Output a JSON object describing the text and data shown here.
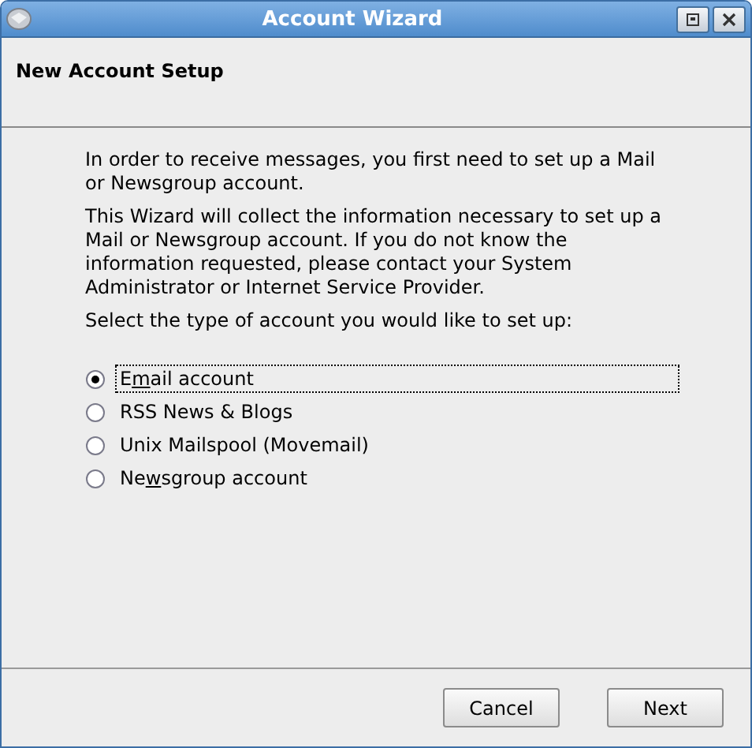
{
  "window": {
    "title": "Account Wizard"
  },
  "header": {
    "title": "New Account Setup"
  },
  "paragraphs": [
    "In order to receive messages, you first need to set up a Mail or Newsgroup account.",
    "This Wizard will collect the information necessary to set up a Mail or Newsgroup account. If you do not know the information requested, please contact your System Administrator or Internet Service Provider.",
    "Select the type of account you would like to set up:"
  ],
  "options": [
    {
      "label": "E",
      "mnemonic": "m",
      "label_rest": "ail account",
      "selected": true
    },
    {
      "label": "RSS News & Blogs",
      "selected": false
    },
    {
      "label": "Unix Mailspool (Movemail)",
      "selected": false
    },
    {
      "label": "Ne",
      "mnemonic": "w",
      "label_rest": "sgroup account",
      "selected": false
    }
  ],
  "buttons": [
    "Cancel",
    "Next"
  ]
}
